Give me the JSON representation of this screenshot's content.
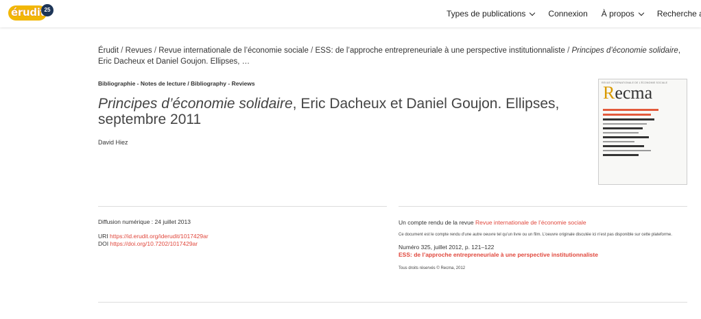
{
  "header": {
    "logo_text": "érudit",
    "logo_badge": "25",
    "nav": [
      {
        "label": "Types de publications",
        "has_dropdown": true
      },
      {
        "label": "Connexion",
        "has_dropdown": false
      },
      {
        "label": "À propos",
        "has_dropdown": true
      },
      {
        "label": "Recherche avancée",
        "has_dropdown": false
      }
    ]
  },
  "breadcrumb": {
    "items": [
      "Érudit",
      "Revues",
      "Revue internationale de l’économie sociale",
      "ESS: de l’approche entrepreneuriale à une perspective institutionnaliste"
    ],
    "current": "Principes d’économie solidaire",
    "current_rest": ", Eric Dacheux et Daniel Goujon. Ellipses, …"
  },
  "article": {
    "section": "Bibliographie - Notes de lecture / Bibliography - Reviews",
    "title_italic": "Principes d’économie solidaire",
    "title_rest": ", Eric Dacheux et Daniel Goujon. Ellipses, septembre 2011",
    "author": "David Hiez"
  },
  "cover": {
    "head": "REVUE INTERNATIONALE DE L'ÉCONOMIE SOCIALE",
    "first_letter": "R",
    "rest": "ecma"
  },
  "meta_left": {
    "diffusion": "Diffusion numérique : 24 juillet 2013",
    "uri_label": "URI",
    "uri": "https://id.erudit.org/iderudit/1017429ar",
    "doi_label": "DOI",
    "doi": "https://doi.org/10.7202/1017429ar"
  },
  "meta_right": {
    "head_prefix": "Un compte rendu de la revue",
    "journal": "Revue internationale de l’économie sociale",
    "note": "Ce document est le compte rendu d’une autre oeuvre tel qu’un livre ou un film. L’oeuvre originale discutée ici n’est pas disponible sur cette plateforme.",
    "issue": "Numéro 325, juillet 2012, p. 121–122",
    "issue_title": "ESS: de l’approche entrepreneuriale à une perspective institutionnaliste",
    "rights": "Tous droits réservés © Recma, 2012"
  },
  "colors": {
    "accent": "#e0463b",
    "logo_yellow": "#f2b705",
    "text": "#333333"
  }
}
